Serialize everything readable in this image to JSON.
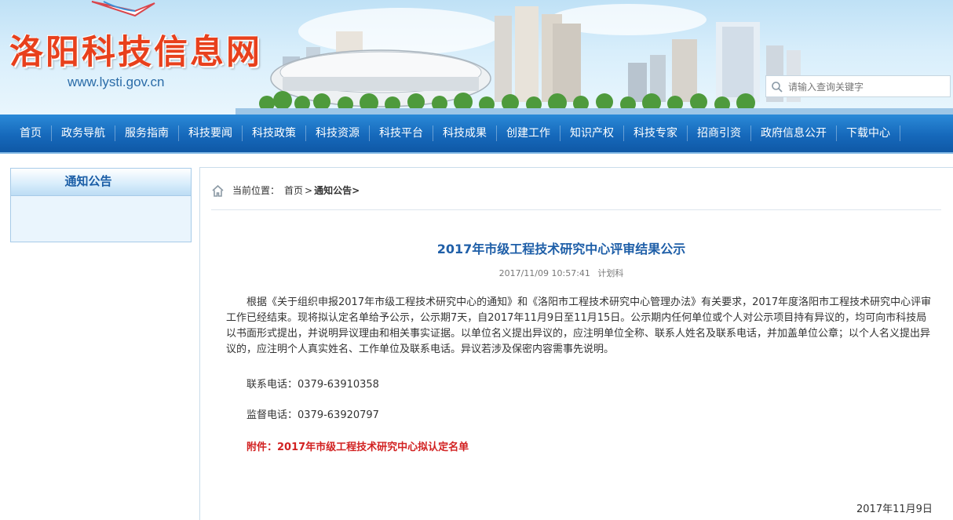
{
  "header": {
    "site_name": "洛阳科技信息网",
    "site_url": "www.lysti.gov.cn",
    "search_placeholder": "请输入查询关键字"
  },
  "nav": {
    "items": [
      "首页",
      "政务导航",
      "服务指南",
      "科技要闻",
      "科技政策",
      "科技资源",
      "科技平台",
      "科技成果",
      "创建工作",
      "知识产权",
      "科技专家",
      "招商引资",
      "政府信息公开",
      "下载中心"
    ]
  },
  "sidebar": {
    "title": "通知公告"
  },
  "breadcrumb": {
    "label": "当前位置：",
    "home": "首页",
    "separator": ">",
    "current": "通知公告>"
  },
  "article": {
    "title": "2017年市级工程技术研究中心评审结果公示",
    "timestamp": "2017/11/09 10:57:41",
    "source": "计划科",
    "body": "根据《关于组织申报2017年市级工程技术研究中心的通知》和《洛阳市工程技术研究中心管理办法》有关要求，2017年度洛阳市工程技术研究中心评审工作已经结束。现将拟认定名单给予公示，公示期7天，自2017年11月9日至11月15日。公示期内任何单位或个人对公示项目持有异议的，均可向市科技局以书面形式提出，并说明异议理由和相关事实证据。以单位名义提出异议的，应注明单位全称、联系人姓名及联系电话，并加盖单位公章；以个人名义提出异议的，应注明个人真实姓名、工作单位及联系电话。异议若涉及保密内容需事先说明。",
    "contact_phone": "联系电话：0379-63910358",
    "supervise_phone": "监督电话：0379-63920797",
    "attachment": "附件：2017年市级工程技术研究中心拟认定名单",
    "date_sign": "2017年11月9日"
  },
  "colors": {
    "logo_red": "#e8401c",
    "nav_blue": "#1669bb",
    "title_blue": "#1f5fa8",
    "attachment_red": "#d22222"
  }
}
